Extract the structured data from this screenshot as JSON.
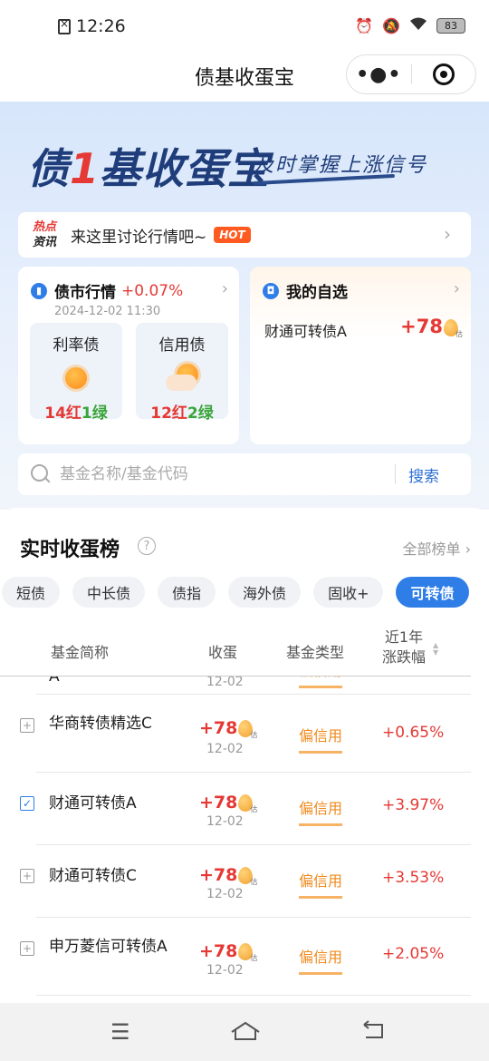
{
  "status": {
    "time": "12:26",
    "battery": "83"
  },
  "titlebar": {
    "title": "债基收蛋宝",
    "more_icon": "•●•"
  },
  "banner": {
    "title_a": "债",
    "title_one": "1",
    "title_b": "基收蛋宝",
    "slogan": "及时掌握上涨信号"
  },
  "hot": {
    "tag_a": "热点",
    "tag_b": "资讯",
    "text": "来这里讨论行情吧~",
    "badge": "HOT",
    "arrow": "›"
  },
  "market": {
    "title": "债市行情",
    "change": "+0.07%",
    "date": "2024-12-02 11:30",
    "arrow": "›",
    "items": [
      {
        "label": "利率债",
        "red": "14红",
        "green": "1绿"
      },
      {
        "label": "信用债",
        "red": "12红",
        "green": "2绿"
      }
    ]
  },
  "watch": {
    "title": "我的自选",
    "arrow": "›",
    "item_name": "财通可转债A",
    "item_value": "+78"
  },
  "search": {
    "placeholder": "基金名称/基金代码",
    "button": "搜索"
  },
  "ranking": {
    "title": "实时收蛋榜",
    "help": "?",
    "all": "全部榜单 ›",
    "tabs": [
      "短债",
      "中长债",
      "债指",
      "海外债",
      "固收+",
      "可转债"
    ],
    "active_tab": "可转债",
    "columns": {
      "name": "基金简称",
      "egg": "收蛋",
      "type": "基金类型",
      "change_a": "近1年",
      "change_b": "涨跌幅"
    },
    "rows": [
      {
        "name": "A",
        "value": "",
        "date": "12-02",
        "type": "偏信用",
        "change": "",
        "checked": false
      },
      {
        "name": "华商转债精选C",
        "value": "+78",
        "date": "12-02",
        "type": "偏信用",
        "change": "+0.65%",
        "checked": false
      },
      {
        "name": "财通可转债A",
        "value": "+78",
        "date": "12-02",
        "type": "偏信用",
        "change": "+3.97%",
        "checked": true
      },
      {
        "name": "财通可转债C",
        "value": "+78",
        "date": "12-02",
        "type": "偏信用",
        "change": "+3.53%",
        "checked": false
      },
      {
        "name": "申万菱信可转债A",
        "value": "+78",
        "date": "12-02",
        "type": "偏信用",
        "change": "+2.05%",
        "checked": false
      }
    ]
  },
  "colors": {
    "accent": "#2f7ee8",
    "up": "#e53935",
    "down": "#3aa53a",
    "type": "#f08a1c"
  },
  "icons": [
    "sim-icon",
    "alarm-icon",
    "mute-icon",
    "wifi-icon",
    "battery-icon",
    "more-icon",
    "close-icon",
    "search-icon",
    "menu-icon",
    "home-icon",
    "back-icon"
  ]
}
